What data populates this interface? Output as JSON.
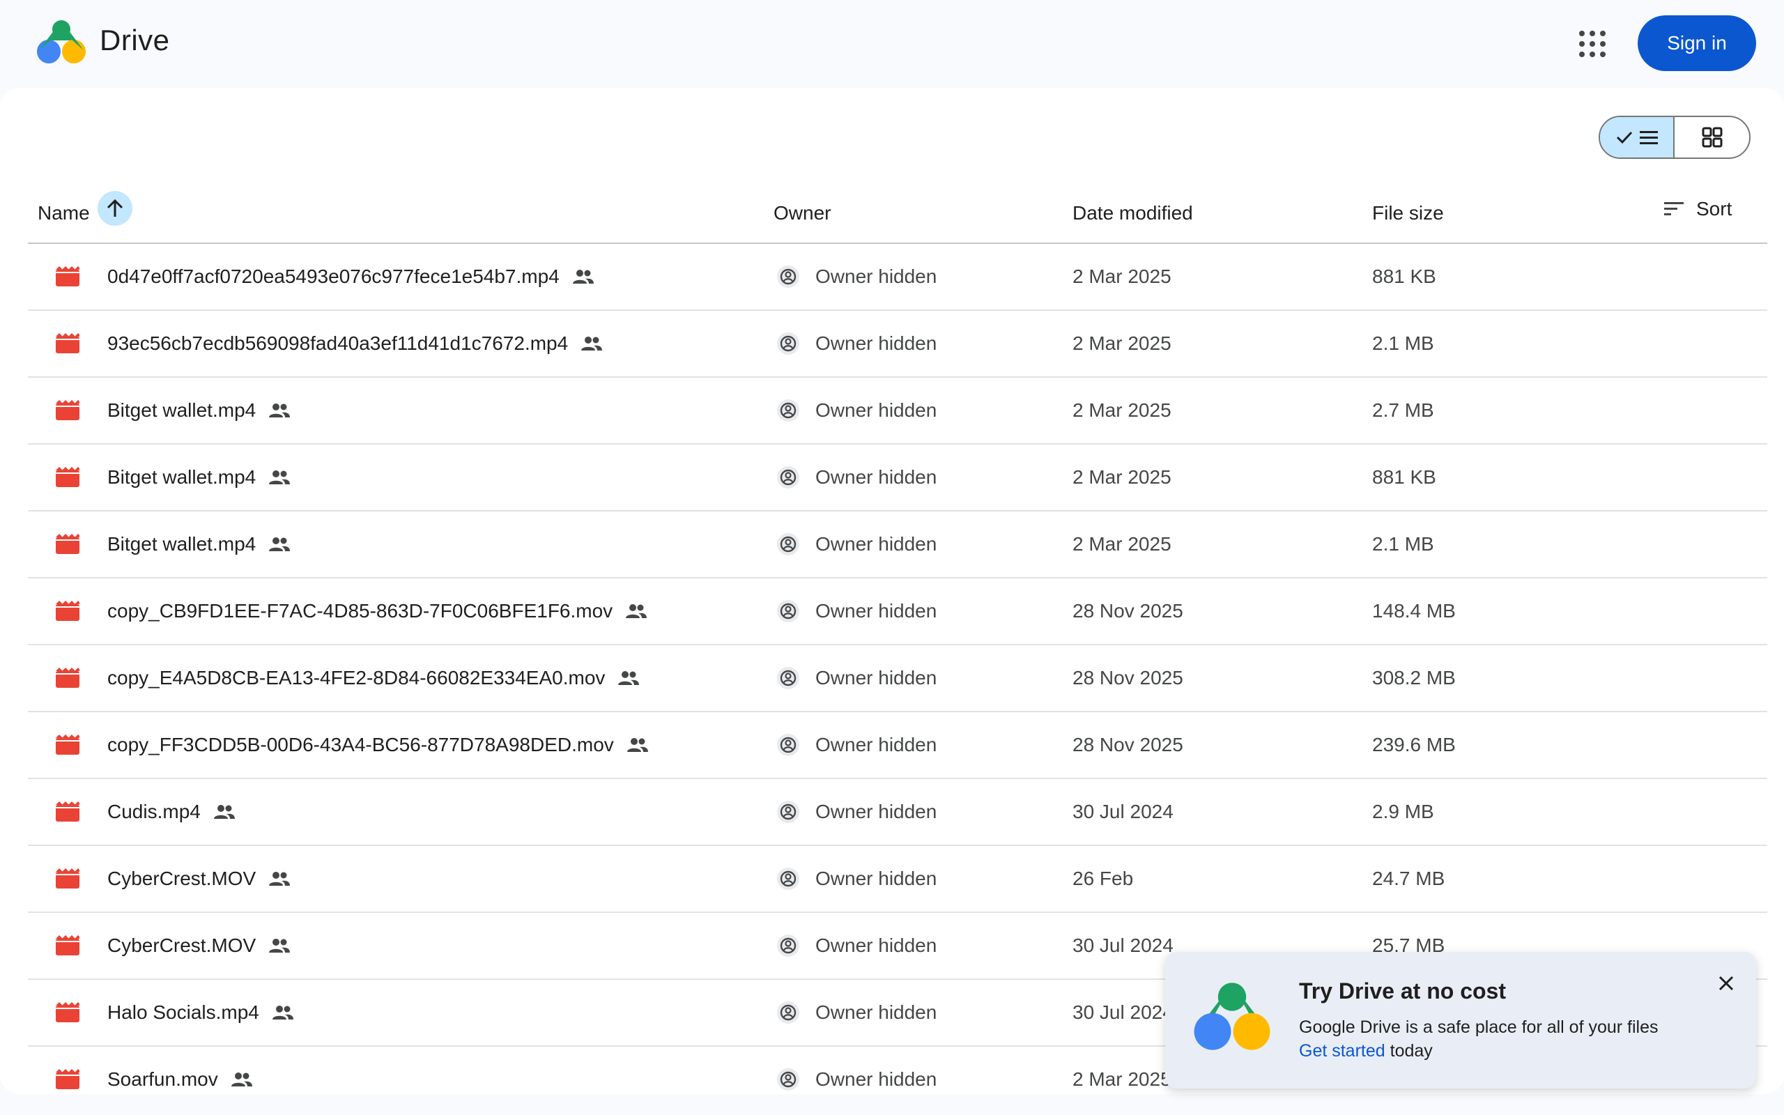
{
  "app": {
    "brand": "Drive",
    "signin_label": "Sign in"
  },
  "columns": {
    "name": "Name",
    "owner": "Owner",
    "date": "Date modified",
    "size": "File size",
    "sort": "Sort"
  },
  "rows": [
    {
      "name": "0d47e0ff7acf0720ea5493e076c977fece1e54b7.mp4",
      "owner": "Owner hidden",
      "date": "2 Mar 2025",
      "size": "881 KB"
    },
    {
      "name": "93ec56cb7ecdb569098fad40a3ef11d41d1c7672.mp4",
      "owner": "Owner hidden",
      "date": "2 Mar 2025",
      "size": "2.1 MB"
    },
    {
      "name": "Bitget wallet.mp4",
      "owner": "Owner hidden",
      "date": "2 Mar 2025",
      "size": "2.7 MB"
    },
    {
      "name": "Bitget wallet.mp4",
      "owner": "Owner hidden",
      "date": "2 Mar 2025",
      "size": "881 KB"
    },
    {
      "name": "Bitget wallet.mp4",
      "owner": "Owner hidden",
      "date": "2 Mar 2025",
      "size": "2.1 MB"
    },
    {
      "name": "copy_CB9FD1EE-F7AC-4D85-863D-7F0C06BFE1F6.mov",
      "owner": "Owner hidden",
      "date": "28 Nov 2025",
      "size": "148.4 MB"
    },
    {
      "name": "copy_E4A5D8CB-EA13-4FE2-8D84-66082E334EA0.mov",
      "owner": "Owner hidden",
      "date": "28 Nov 2025",
      "size": "308.2 MB"
    },
    {
      "name": "copy_FF3CDD5B-00D6-43A4-BC56-877D78A98DED.mov",
      "owner": "Owner hidden",
      "date": "28 Nov 2025",
      "size": "239.6 MB"
    },
    {
      "name": "Cudis.mp4",
      "owner": "Owner hidden",
      "date": "30 Jul 2024",
      "size": "2.9 MB"
    },
    {
      "name": "CyberCrest.MOV",
      "owner": "Owner hidden",
      "date": "26 Feb",
      "size": "24.7 MB"
    },
    {
      "name": "CyberCrest.MOV",
      "owner": "Owner hidden",
      "date": "30 Jul 2024",
      "size": "25.7 MB"
    },
    {
      "name": "Halo Socials.mp4",
      "owner": "Owner hidden",
      "date": "30 Jul 2024",
      "size": ""
    },
    {
      "name": "Soarfun.mov",
      "owner": "Owner hidden",
      "date": "2 Mar 2025",
      "size": ""
    }
  ],
  "promo": {
    "title": "Try Drive at no cost",
    "text": "Google Drive is a safe place for all of your files",
    "link": "Get started",
    "suffix": " today"
  },
  "colors": {
    "accent": "#0b57d0",
    "selected": "#c2e7ff",
    "file_icon": "#ea4335"
  }
}
